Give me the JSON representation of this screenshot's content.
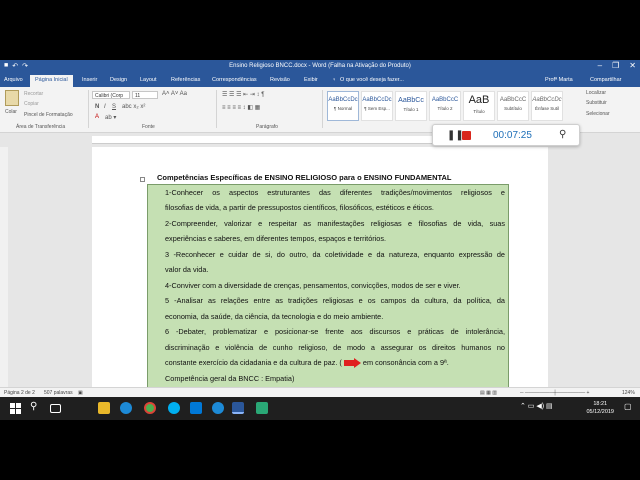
{
  "window": {
    "title": "Ensino Religioso BNCC.docx  -  Word (Falha na Ativação do Produto)",
    "controls": [
      "–",
      "❐",
      "✕"
    ]
  },
  "ribbon_tabs": {
    "arquivo": "Arquivo",
    "pagina_inicial": "Página Inicial",
    "inserir": "Inserir",
    "design": "Design",
    "layout": "Layout",
    "referencias": "Referências",
    "correspondencias": "Correspondências",
    "revisao": "Revisão",
    "exibir": "Exibir",
    "tell_me": "O que você deseja fazer...",
    "user": "Profª Marta",
    "share": "Compartilhar"
  },
  "ribbon": {
    "clipboard": {
      "paste": "Colar",
      "cut": "Recortar",
      "copy": "Copiar",
      "format_painter": "Pincel de Formatação",
      "group_label": "Área de Transferência"
    },
    "font": {
      "name": "Calibri (Corp",
      "size": "11",
      "group_label": "Fonte"
    },
    "paragraph": {
      "group_label": "Parágrafo"
    },
    "styles": [
      {
        "sample": "AaBbCcDc",
        "label": "¶ Normal"
      },
      {
        "sample": "AaBbCcDc",
        "label": "¶ Sem Esp..."
      },
      {
        "sample": "AaBbCc",
        "label": "Título 1"
      },
      {
        "sample": "AaBbCcC",
        "label": "Título 2"
      },
      {
        "sample": "AaB",
        "label": "Título"
      },
      {
        "sample": "AaBbCcC",
        "label": "Subtítulo"
      },
      {
        "sample": "AaBbCcDc",
        "label": "Ênfase Sutil"
      }
    ],
    "editing": {
      "find": "Localizar",
      "replace": "Substituir",
      "select": "Selecionar"
    }
  },
  "recorder": {
    "time": "00:07:25"
  },
  "document": {
    "heading": "Competências Específicas de ENSINO RELIGIOSO para o ENSINO FUNDAMENTAL",
    "lines": [
      "1-Conhecer os aspectos estruturantes das diferentes tradições/movimentos religiosos e",
      "filosofias de vida, a partir de pressupostos científicos, filosóficos, estéticos e éticos.",
      "2-Compreender, valorizar e respeitar as manifestações religiosas e filosofias de vida, suas",
      "experiências e saberes, em diferentes tempos, espaços e territórios.",
      "3 -Reconhecer e cuidar de si, do outro, da coletividade e da natureza, enquanto expressão de",
      "valor da vida.",
      "4-Conviver com a diversidade de crenças, pensamentos, convicções, modos de ser e viver.",
      "5 -Analisar as relações entre as tradições religiosas e os campos da cultura, da política, da",
      "economia, da saúde, da ciência, da tecnologia e do meio ambiente.",
      "6 -Debater, problematizar e posicionar-se frente aos discursos e práticas de intolerância,",
      "discriminação e violência de cunho religioso, de modo a assegurar os direitos humanos no",
      "constante exercício da cidadania e da cultura de paz.  (",
      "Competência geral da BNCC : Empatia)"
    ],
    "line12_tail": "em consonância com a 9ª."
  },
  "status": {
    "page": "Página 2 de 2",
    "words": "507 palavras",
    "zoom": "124%"
  },
  "taskbar": {
    "time": "18:21",
    "date": "05/12/2019"
  }
}
